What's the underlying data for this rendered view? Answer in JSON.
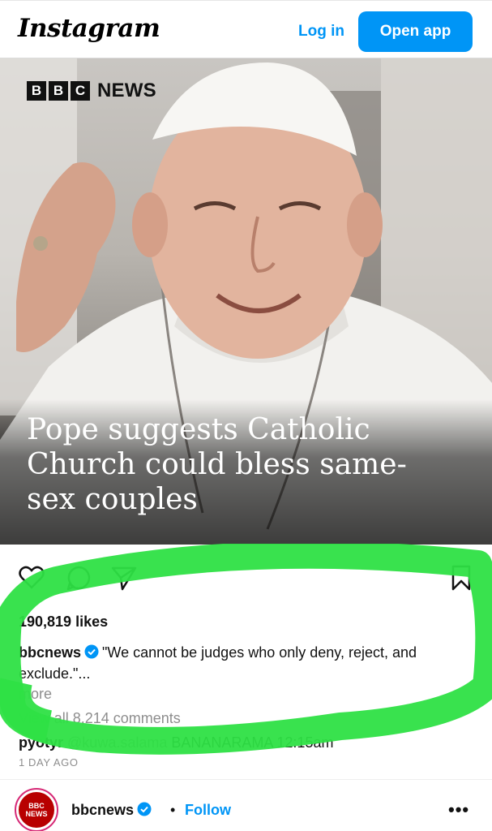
{
  "header": {
    "logo": "Instagram",
    "login_label": "Log in",
    "open_app_label": "Open app"
  },
  "post": {
    "brand": {
      "blocks": [
        "B",
        "B",
        "C"
      ],
      "name": "NEWS"
    },
    "headline": "Pope suggests Catholic Church could bless same-sex couples",
    "actions": [
      "heart-icon",
      "comment-icon",
      "share-icon",
      "bookmark-icon"
    ],
    "likes": "190,819 likes",
    "caption": {
      "username": "bbcnews",
      "text": "\"We cannot be judges who only deny, reject, and exclude.\"..."
    },
    "more_label": "more",
    "comments_label": "View all 8,214 comments",
    "comment": {
      "username": "pyotyr",
      "mention": "@kuwa.salama",
      "text": "BANANARAMA 12:15am"
    },
    "time_ago": "1 DAY AGO"
  },
  "author": {
    "avatar_text": [
      "BBC",
      "NEWS"
    ],
    "username": "bbcnews",
    "separator": "•",
    "follow_label": "Follow",
    "more_options": "•••"
  },
  "colors": {
    "accent": "#0095f6",
    "highlight": "#2ee045",
    "verified": "#0095f6"
  }
}
